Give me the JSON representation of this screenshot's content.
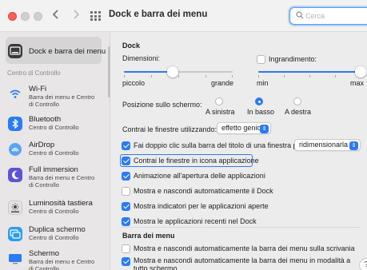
{
  "window": {
    "title": "Dock e barra dei menu"
  },
  "search": {
    "placeholder": "Cerca"
  },
  "colors": {
    "accent": "#2a7bf6",
    "close": "#fe5f57"
  },
  "sidebar": {
    "section_label": "Centro di Controllo",
    "items": [
      {
        "label": "Dock e barra dei menu",
        "sub": "",
        "icon": "dock-icon",
        "selected": true
      },
      {
        "label": "Wi-Fi",
        "sub": "Barra dei menu e Centro|di Controllo",
        "icon": "wifi-icon"
      },
      {
        "label": "Bluetooth",
        "sub": "Centro di Controllo",
        "icon": "bluetooth-icon"
      },
      {
        "label": "AirDrop",
        "sub": "Centro di Controllo",
        "icon": "airdrop-icon"
      },
      {
        "label": "Full immersion",
        "sub": "Barra dei menu e Centro|di Controllo",
        "icon": "moon-icon"
      },
      {
        "label": "Luminosità tastiera",
        "sub": "Centro di Controllo",
        "icon": "keyboard-brightness-icon"
      },
      {
        "label": "Duplica schermo",
        "sub": "Centro di Controllo",
        "icon": "screen-mirroring-icon"
      },
      {
        "label": "Schermo",
        "sub": "Barra dei menu e Centro|di Controllo",
        "icon": "display-icon"
      }
    ]
  },
  "dock": {
    "title": "Dock",
    "size_label": "Dimensioni:",
    "size_min": "piccolo",
    "size_max": "grande",
    "size_value": 0.45,
    "magnification_label": "Ingrandimento:",
    "magnification_checked": false,
    "mag_min": "min",
    "mag_max": "max",
    "mag_value": 1.0,
    "position_label": "Posizione sullo schermo:",
    "positions": [
      "A sinistra",
      "In basso",
      "A destra"
    ],
    "position_selected": "In basso",
    "minimize_label": "Contrai le finestre utilizzando:",
    "minimize_value": "effetto genio",
    "doubleclick_label": "Fai doppio clic sulla barra del titolo di una finestra per",
    "doubleclick_value": "ridimensionarla",
    "doubleclick_checked": true,
    "options": [
      {
        "label": "Contrai le finestre in icona applicazione",
        "checked": true,
        "focused": true
      },
      {
        "label": "Animazione all'apertura delle applicazioni",
        "checked": true
      },
      {
        "label": "Mostra e nascondi automaticamente il Dock",
        "checked": false
      },
      {
        "label": "Mostra indicatori per le applicazioni aperte",
        "checked": true
      },
      {
        "label": "Mostra le applicazioni recenti nel Dock",
        "checked": true
      }
    ]
  },
  "menubar": {
    "title": "Barra dei menu",
    "options": [
      {
        "label": "Mostra e nascondi automaticamente la barra dei menu sulla scrivania",
        "checked": false
      },
      {
        "label": "Mostra e nascondi automaticamente la barra dei menu in modalità a|tutto schermo",
        "checked": true
      }
    ]
  },
  "help": {
    "label": "?"
  }
}
